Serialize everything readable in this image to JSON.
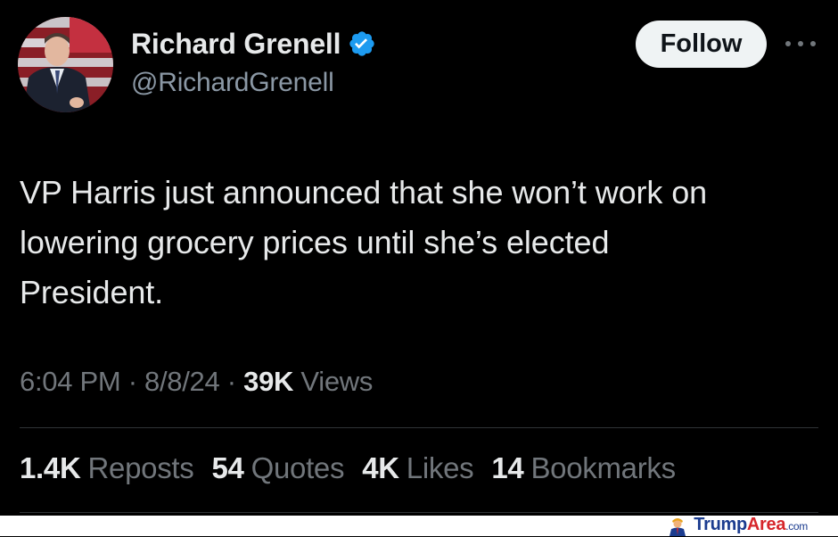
{
  "author": {
    "display_name": "Richard Grenell",
    "handle": "@RichardGrenell",
    "verified": true
  },
  "header": {
    "follow_label": "Follow"
  },
  "tweet": {
    "text": "VP Harris just announced that she won’t work on\nlowering grocery prices until she’s elected\nPresident.",
    "time": "6:04 PM",
    "date": "8/8/24",
    "views_count": "39K",
    "views_label": "Views",
    "separator": "·"
  },
  "stats": [
    {
      "count": "1.4K",
      "label": "Reposts"
    },
    {
      "count": "54",
      "label": "Quotes"
    },
    {
      "count": "4K",
      "label": "Likes"
    },
    {
      "count": "14",
      "label": "Bookmarks"
    }
  ],
  "watermark": {
    "part1": "Trump",
    "part2": "Area",
    "part3": ".com"
  },
  "colors": {
    "background": "#000000",
    "primary_text": "#e7e9ea",
    "secondary_text": "#71767b",
    "verified_blue": "#1d9bf0",
    "follow_button_bg": "#eff3f4"
  },
  "icons": {
    "verified": "verified-badge-icon",
    "more": "more-options-icon",
    "watermark_logo": "trump-figure-icon"
  }
}
